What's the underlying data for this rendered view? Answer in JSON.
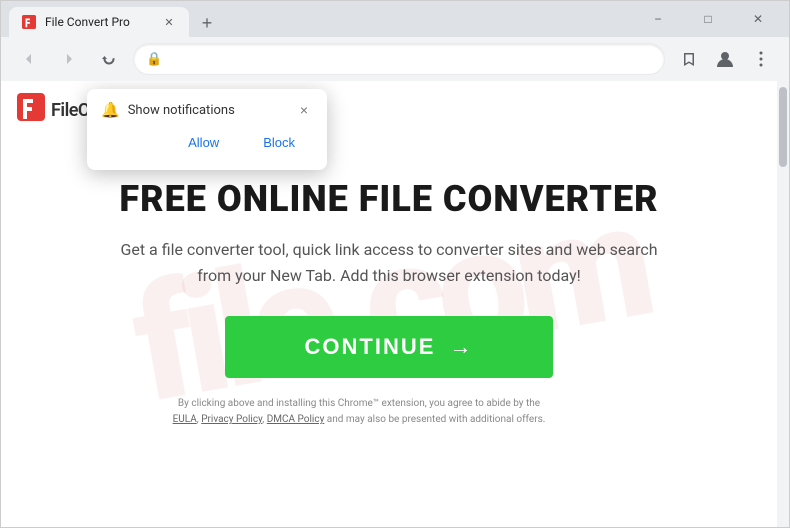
{
  "browser": {
    "tab_title": "File Convert Pro",
    "new_tab_label": "+",
    "window_controls": {
      "minimize": "−",
      "maximize": "□",
      "close": "✕"
    },
    "nav": {
      "back_title": "Back",
      "forward_title": "Forward",
      "refresh_title": "Refresh",
      "address": "",
      "bookmark_title": "Bookmark",
      "profile_title": "Profile",
      "menu_title": "Menu"
    }
  },
  "notification_popup": {
    "bell_icon": "🔔",
    "title": "Show notifications",
    "close_label": "×",
    "allow_label": "Allow",
    "block_label": "Block"
  },
  "page": {
    "logo_text": "FileCo",
    "main_title": "FREE ONLINE FILE CONVERTER",
    "subtitle": "Get a file converter tool, quick link access to converter sites and web search from your New Tab. Add this browser extension today!",
    "continue_label": "CONTINUE",
    "continue_arrow": "→",
    "fine_print": "By clicking above and installing this Chrome™ extension, you agree to abide by the",
    "fine_links": [
      "EULA",
      "Privacy Policy",
      "DMCA Policy"
    ],
    "fine_print_end": "and may also be presented with additional offers.",
    "watermark": "file.com"
  }
}
